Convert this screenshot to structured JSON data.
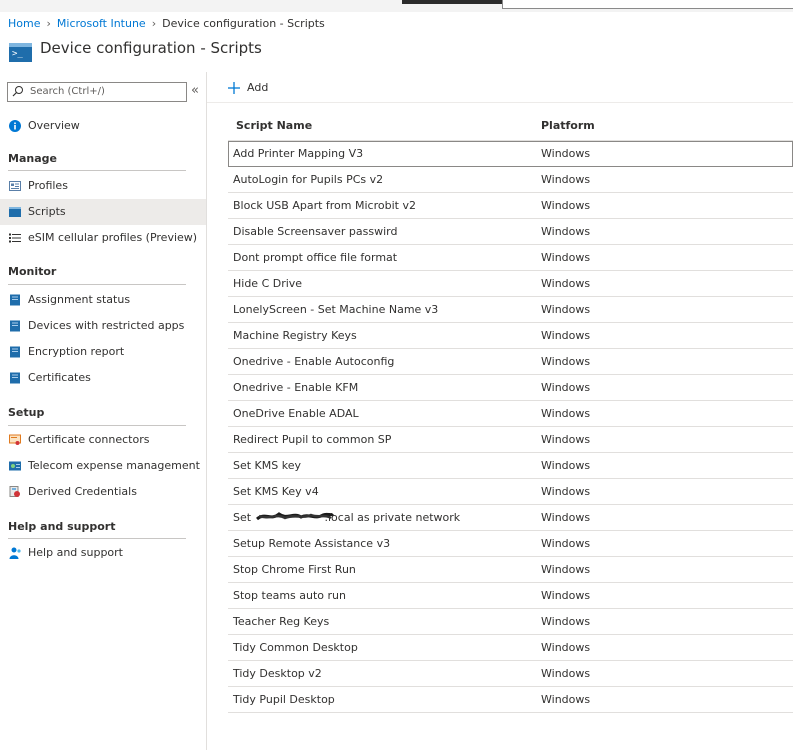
{
  "breadcrumb": {
    "home": "Home",
    "intune": "Microsoft Intune",
    "current": "Device configuration - Scripts"
  },
  "page": {
    "title": "Device configuration - Scripts"
  },
  "sidebar": {
    "search_placeholder": "Search (Ctrl+/)",
    "collapse_glyph": "«",
    "overview": "Overview",
    "manage": {
      "header": "Manage",
      "items": [
        "Profiles",
        "Scripts",
        "eSIM cellular profiles (Preview)"
      ]
    },
    "monitor": {
      "header": "Monitor",
      "items": [
        "Assignment status",
        "Devices with restricted apps",
        "Encryption report",
        "Certificates"
      ]
    },
    "setup": {
      "header": "Setup",
      "items": [
        "Certificate connectors",
        "Telecom expense management",
        "Derived Credentials"
      ]
    },
    "help": {
      "header": "Help and support",
      "items": [
        "Help and support"
      ]
    }
  },
  "toolbar": {
    "add_label": "Add"
  },
  "table": {
    "columns": [
      "Script Name",
      "Platform"
    ],
    "rows": [
      {
        "name": "Add Printer Mapping V3",
        "platform": "Windows"
      },
      {
        "name": "AutoLogin for Pupils PCs v2",
        "platform": "Windows"
      },
      {
        "name": "Block USB Apart from Microbit v2",
        "platform": "Windows"
      },
      {
        "name": "Disable Screensaver passwird",
        "platform": "Windows"
      },
      {
        "name": "Dont prompt office file format",
        "platform": "Windows"
      },
      {
        "name": "Hide C Drive",
        "platform": "Windows"
      },
      {
        "name": "LonelyScreen - Set Machine Name v3",
        "platform": "Windows"
      },
      {
        "name": "Machine Registry Keys",
        "platform": "Windows"
      },
      {
        "name": "Onedrive - Enable Autoconfig",
        "platform": "Windows"
      },
      {
        "name": "Onedrive - Enable KFM",
        "platform": "Windows"
      },
      {
        "name": "OneDrive Enable ADAL",
        "platform": "Windows"
      },
      {
        "name": "Redirect Pupil to common SP",
        "platform": "Windows"
      },
      {
        "name": "Set KMS key",
        "platform": "Windows"
      },
      {
        "name": "Set KMS Key v4",
        "platform": "Windows"
      },
      {
        "name": "Set                     .local as private network",
        "platform": "Windows"
      },
      {
        "name": "Setup Remote Assistance v3",
        "platform": "Windows"
      },
      {
        "name": "Stop Chrome First Run",
        "platform": "Windows"
      },
      {
        "name": "Stop teams auto run",
        "platform": "Windows"
      },
      {
        "name": "Teacher Reg Keys",
        "platform": "Windows"
      },
      {
        "name": "Tidy Common Desktop",
        "platform": "Windows"
      },
      {
        "name": "Tidy Desktop v2",
        "platform": "Windows"
      },
      {
        "name": "Tidy Pupil Desktop",
        "platform": "Windows"
      }
    ]
  },
  "colors": {
    "link": "#0078d4",
    "accent": "#0078d4",
    "selected_nav": "#edebe9"
  }
}
